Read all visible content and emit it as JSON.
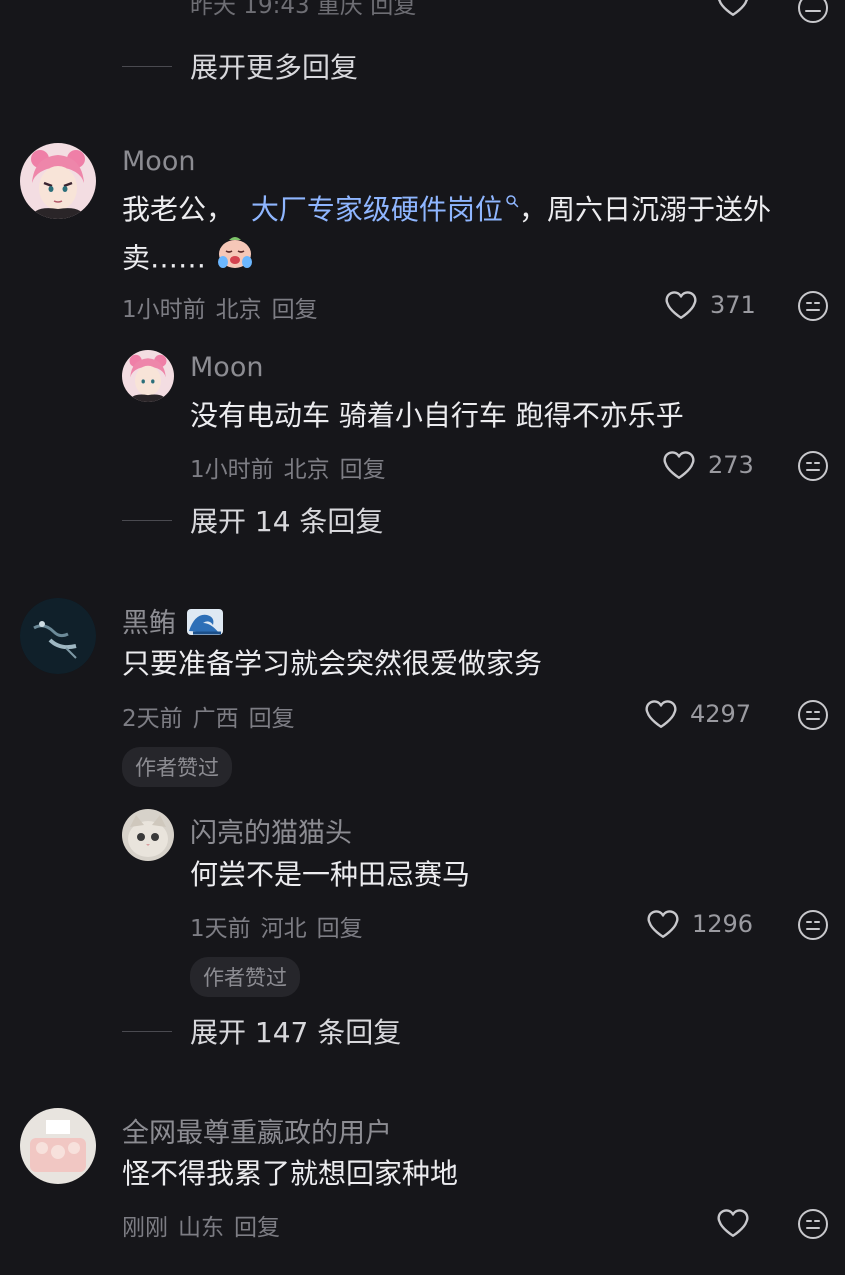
{
  "top_partial": {
    "meta_text": "昨天 19:43 重庆 回复",
    "expand_label": "展开更多回复"
  },
  "comments": [
    {
      "author": "Moon",
      "text_before": "我老公，",
      "link_text": "大厂专家级硬件岗位",
      "text_after": "，周六日沉溺于送外卖……",
      "time": "1小时前",
      "location": "北京",
      "reply": "回复",
      "likes": "371",
      "replies": [
        {
          "author": "Moon",
          "text": "没有电动车 骑着小自行车 跑得不亦乐乎",
          "time": "1小时前",
          "location": "北京",
          "reply": "回复",
          "likes": "273"
        }
      ],
      "expand_label": "展开 14 条回复"
    },
    {
      "author": "黑鲔",
      "text": "只要准备学习就会突然很爱做家务",
      "time": "2天前",
      "location": "广西",
      "reply": "回复",
      "likes": "4297",
      "badge": "作者赞过",
      "replies": [
        {
          "author": "闪亮的猫猫头",
          "text": "何尝不是一种田忌赛马",
          "time": "1天前",
          "location": "河北",
          "reply": "回复",
          "likes": "1296",
          "badge": "作者赞过"
        }
      ],
      "expand_label": "展开 147 条回复"
    },
    {
      "author": "全网最尊重嬴政的用户",
      "text": "怪不得我累了就想回家种地",
      "time": "刚刚",
      "location": "山东",
      "reply": "回复",
      "likes": ""
    }
  ],
  "icons": {
    "like": "heart-outline-icon",
    "emoji_reaction": "smiley-face-icon",
    "search_hint": "search-icon",
    "crying_emoji": "crying-face-emoji",
    "wave_emoji": "wave-emoji"
  },
  "colors": {
    "background": "#16161a",
    "link": "#8fb6ff",
    "text": "#ececef",
    "muted": "#7d7d84"
  }
}
